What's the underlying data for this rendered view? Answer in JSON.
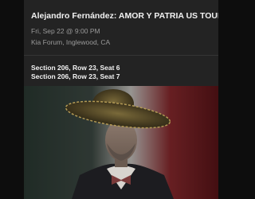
{
  "event": {
    "title": "Alejandro Fernández: AMOR Y PATRIA US TOUR",
    "datetime": "Fri, Sep 22 @ 9:00 PM",
    "venue": "Kia Forum, Inglewood, CA"
  },
  "tickets": [
    {
      "seat_label": "Section 206, Row 23, Seat 6"
    },
    {
      "seat_label": "Section 206, Row 23, Seat 7"
    }
  ],
  "colors": {
    "card_background": "#232323",
    "page_background": "#0d0d0d",
    "title_text": "#f2f2f2",
    "secondary_text": "#9a9a9a"
  }
}
